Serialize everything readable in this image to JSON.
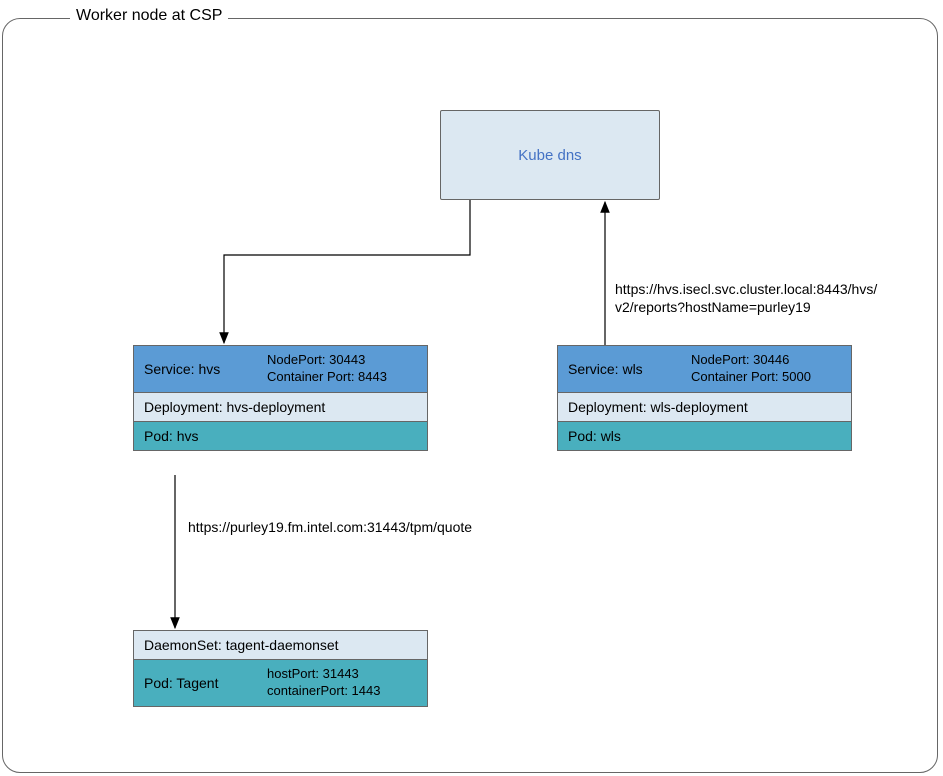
{
  "frame_title": "Worker node at CSP",
  "kube_dns": "Kube dns",
  "hvs_stack": {
    "service_label": "Service: hvs",
    "node_port": "NodePort: 30443",
    "container_port": "Container Port: 8443",
    "deployment": "Deployment: hvs-deployment",
    "pod": "Pod: hvs"
  },
  "wls_stack": {
    "service_label": "Service: wls",
    "node_port": "NodePort: 30446",
    "container_port": "Container Port: 5000",
    "deployment": "Deployment: wls-deployment",
    "pod": "Pod: wls"
  },
  "tagent_stack": {
    "daemonset": "DaemonSet: tagent-daemonset",
    "pod_label": "Pod: Tagent",
    "host_port": "hostPort: 31443",
    "container_port": "containerPort: 1443"
  },
  "url_right_line1": "https://hvs.isecl.svc.cluster.local:8443/hvs/",
  "url_right_line2": "v2/reports?hostName=purley19",
  "url_left": "https://purley19.fm.intel.com:31443/tpm/quote",
  "chart_data": {
    "type": "diagram",
    "title": "Worker node at CSP",
    "nodes": [
      {
        "id": "kube-dns",
        "label": "Kube dns"
      },
      {
        "id": "hvs",
        "label": "Service: hvs",
        "nodePort": 30443,
        "containerPort": 8443,
        "deployment": "hvs-deployment",
        "pod": "hvs"
      },
      {
        "id": "wls",
        "label": "Service: wls",
        "nodePort": 30446,
        "containerPort": 5000,
        "deployment": "wls-deployment",
        "pod": "wls"
      },
      {
        "id": "tagent",
        "label": "DaemonSet: tagent-daemonset",
        "pod": "Tagent",
        "hostPort": 31443,
        "containerPort": 1443
      }
    ],
    "edges": [
      {
        "from": "kube-dns",
        "to": "hvs"
      },
      {
        "from": "wls",
        "to": "kube-dns",
        "label": "https://hvs.isecl.svc.cluster.local:8443/hvs/v2/reports?hostName=purley19"
      },
      {
        "from": "hvs",
        "to": "tagent",
        "label": "https://purley19.fm.intel.com:31443/tpm/quote"
      }
    ]
  }
}
